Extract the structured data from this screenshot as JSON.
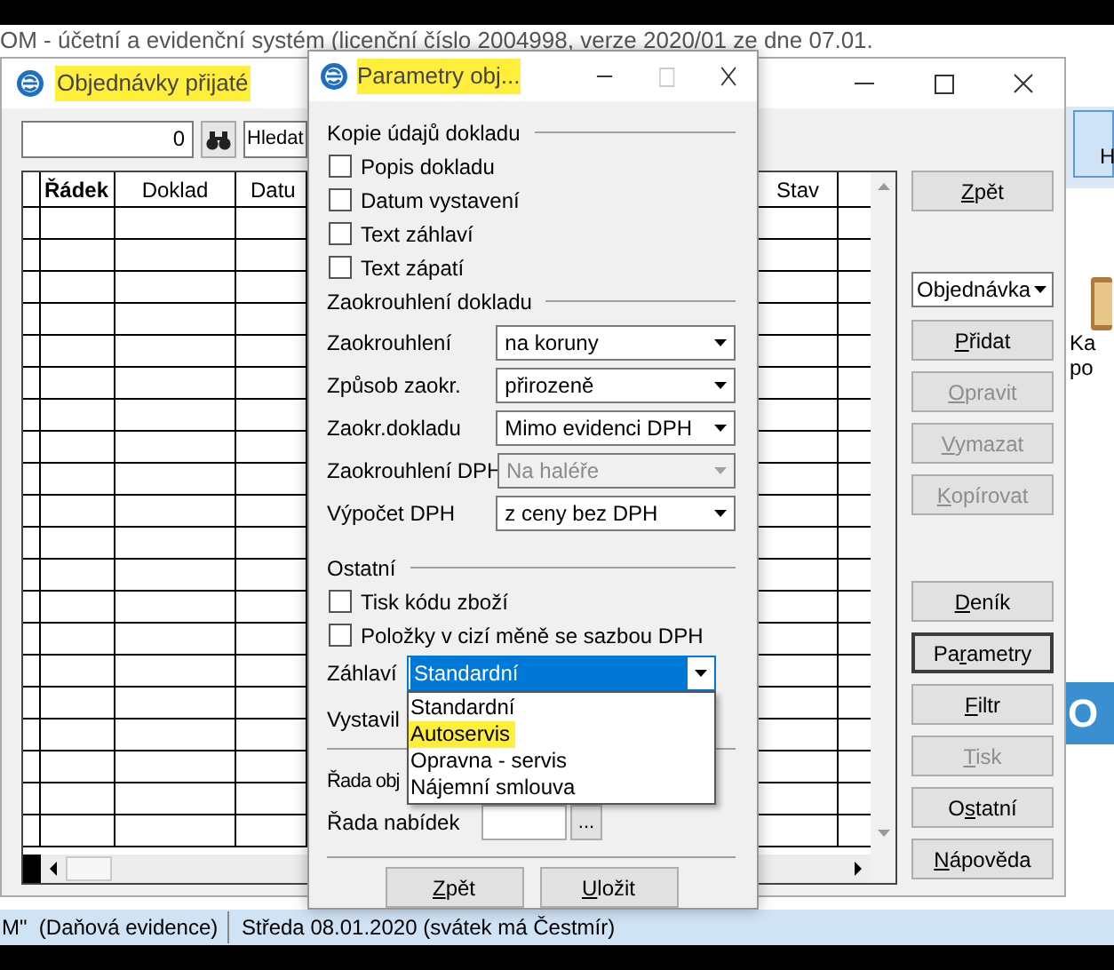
{
  "app_title": "OM - účetní a evidenční systém (licenční číslo 2004998, verze 2020/01 ze dne 07.01.",
  "background_panel": {
    "tab_label": "H",
    "texts": [
      "Ka",
      "po"
    ],
    "banner": "O"
  },
  "main_window": {
    "title": "Objednávky přijaté",
    "highlighted": true,
    "search": {
      "value": "0"
    },
    "find_field": {
      "value": "Hledat"
    },
    "table": {
      "columns": [
        {
          "label": "Řádek",
          "bold": true
        },
        {
          "label": "Doklad",
          "bold": false
        },
        {
          "label": "Datu",
          "bold": false
        },
        {
          "label": "Stav",
          "bold": false
        }
      ]
    },
    "buttons": [
      {
        "kind": "button",
        "label": {
          "key": "Z",
          "post": "pět"
        },
        "disabled": false,
        "focused": false
      },
      {
        "kind": "combo",
        "label": "Objednávka"
      },
      {
        "kind": "button",
        "label": {
          "key": "P",
          "post": "řidat"
        },
        "disabled": false,
        "focused": false
      },
      {
        "kind": "button",
        "label": {
          "key": "O",
          "post": "pravit"
        },
        "disabled": true,
        "focused": false
      },
      {
        "kind": "button",
        "label": {
          "key": "V",
          "post": "ymazat"
        },
        "disabled": true,
        "focused": false
      },
      {
        "kind": "button",
        "label": {
          "key": "K",
          "post": "opírovat"
        },
        "disabled": true,
        "focused": false
      },
      {
        "kind": "button",
        "label": {
          "key": "D",
          "post": "eník"
        },
        "disabled": false,
        "focused": false
      },
      {
        "kind": "button",
        "label": {
          "pre": "Pa",
          "key": "r",
          "post": "ametry"
        },
        "disabled": false,
        "focused": true
      },
      {
        "kind": "button",
        "label": {
          "key": "F",
          "post": "iltr"
        },
        "disabled": false,
        "focused": false
      },
      {
        "kind": "button",
        "label": {
          "key": "T",
          "post": "isk"
        },
        "disabled": true,
        "focused": false
      },
      {
        "kind": "button",
        "label": {
          "pre": "O",
          "key": "s",
          "post": "tatní"
        },
        "disabled": false,
        "focused": false
      },
      {
        "kind": "button",
        "label": {
          "key": "N",
          "post": "ápověda"
        },
        "disabled": false,
        "focused": false
      }
    ]
  },
  "dialog": {
    "title": "Parametry obj...",
    "highlighted": true,
    "sections": [
      {
        "title": "Kopie údajů dokladu",
        "items": [
          {
            "kind": "checkbox",
            "label": "Popis dokladu",
            "checked": false
          },
          {
            "kind": "checkbox",
            "label": "Datum vystavení",
            "checked": false
          },
          {
            "kind": "checkbox",
            "label": "Text záhlaví",
            "checked": false
          },
          {
            "kind": "checkbox",
            "label": "Text zápatí",
            "checked": false
          }
        ]
      },
      {
        "title": "Zaokrouhlení dokladu",
        "items": [
          {
            "kind": "select",
            "label": "Zaokrouhlení",
            "value": "na koruny",
            "disabled": false
          },
          {
            "kind": "select",
            "label": "Způsob zaokr.",
            "value": "přirozeně",
            "disabled": false
          },
          {
            "kind": "select",
            "label": "Zaokr.dokladu",
            "value": "Mimo evidenci DPH",
            "disabled": false
          },
          {
            "kind": "select",
            "label": "Zaokrouhlení DPH",
            "value": "Na haléře",
            "disabled": true
          },
          {
            "kind": "select",
            "label": "Výpočet DPH",
            "value": "z ceny bez DPH",
            "disabled": false
          }
        ]
      },
      {
        "title": "Ostatní",
        "items": [
          {
            "kind": "checkbox",
            "label": "Tisk kódu zboží",
            "checked": false
          },
          {
            "kind": "checkbox",
            "label": "Položky v cizí měně se sazbou DPH",
            "checked": false
          }
        ]
      }
    ],
    "header_select": {
      "label": "Záhlaví",
      "value": "Standardní",
      "expanded": true,
      "options": [
        {
          "label": "Standardní",
          "highlighted": false
        },
        {
          "label": "Autoservis",
          "highlighted": true
        },
        {
          "label": "Opravna - servis",
          "highlighted": false
        },
        {
          "label": "Nájemní smlouva",
          "highlighted": false
        }
      ]
    },
    "issuer_label": "Vystavil",
    "order_series_label": "Řada obj",
    "offer_series": {
      "label": "Řada nabídek",
      "browse": "..."
    },
    "buttons": [
      {
        "label": {
          "key": "Z",
          "post": "pět"
        }
      },
      {
        "label": {
          "key": "U",
          "post": "ložit"
        }
      }
    ]
  },
  "status_bar": [
    "M\"  (Daňová evidence)",
    "Středa 08.01.2020 (svátek má Čestmír)"
  ]
}
